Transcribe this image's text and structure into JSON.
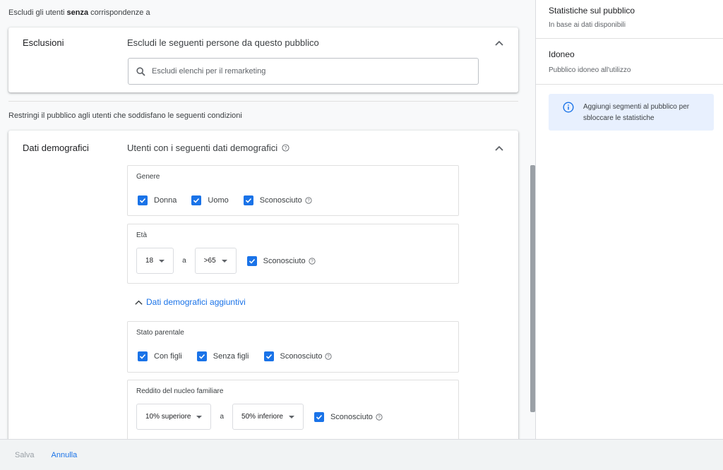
{
  "main": {
    "exclude_intro_prefix": "Escludi gli utenti ",
    "exclude_intro_bold": "senza",
    "exclude_intro_suffix": " corrispondenze a",
    "exclusions": {
      "title": "Esclusioni",
      "subtitle": "Escludi le seguenti persone da questo pubblico",
      "search_placeholder": "Escludi elenchi per il remarketing"
    },
    "restrict_intro": "Restringi il pubblico agli utenti che soddisfano le seguenti condizioni",
    "demographics": {
      "title": "Dati demografici",
      "subtitle": "Utenti con i seguenti dati demografici",
      "gender": {
        "label": "Genere",
        "options": [
          "Donna",
          "Uomo",
          "Sconosciuto"
        ]
      },
      "age": {
        "label": "Età",
        "from": "18",
        "to_sep": "a",
        "to": ">65",
        "unknown": "Sconosciuto"
      },
      "more_toggle": "Dati demografici aggiuntivi",
      "parental": {
        "label": "Stato parentale",
        "options": [
          "Con figli",
          "Senza figli",
          "Sconosciuto"
        ]
      },
      "income": {
        "label": "Reddito del nucleo familiare",
        "from": "10% superiore",
        "to_sep": "a",
        "to": "50% inferiore",
        "unknown": "Sconosciuto"
      }
    }
  },
  "side": {
    "stats_title": "Statistiche sul pubblico",
    "stats_sub": "In base ai dati disponibili",
    "eligible_title": "Idoneo",
    "eligible_sub": "Pubblico idoneo all'utilizzo",
    "info_text": "Aggiungi segmenti al pubblico per sbloccare le statistiche"
  },
  "footer": {
    "save_label": "Salva",
    "cancel_label": "Annulla"
  },
  "colors": {
    "accent": "#1a73e8",
    "info_bg": "#e8f0fe"
  }
}
